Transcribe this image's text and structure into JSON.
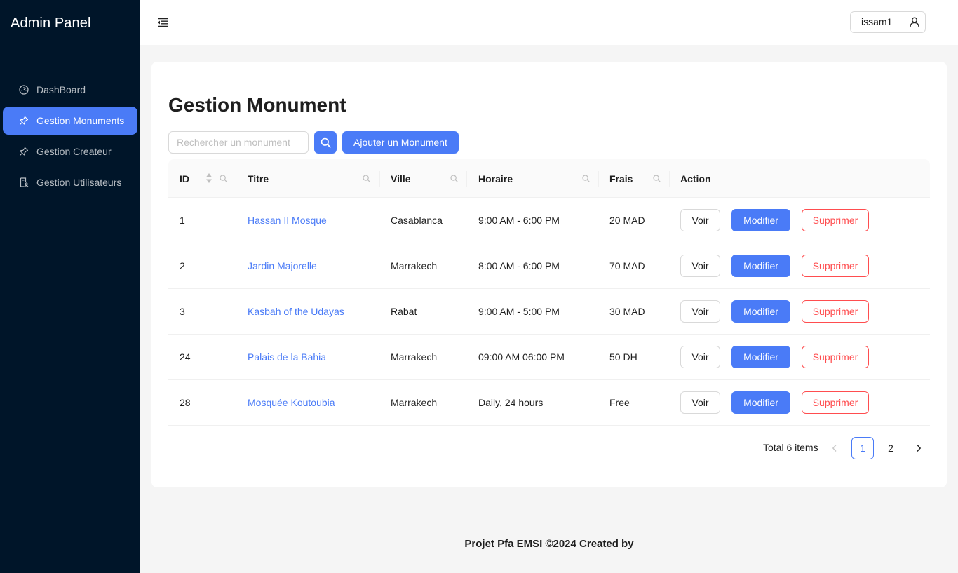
{
  "sidebar": {
    "brand": "Admin Panel",
    "items": [
      {
        "label": "DashBoard",
        "icon": "dashboard-icon",
        "active": false
      },
      {
        "label": "Gestion Monuments",
        "icon": "pushpin-icon",
        "active": true
      },
      {
        "label": "Gestion Createur",
        "icon": "pushpin-icon",
        "active": false
      },
      {
        "label": "Gestion Utilisateurs",
        "icon": "file-user-icon",
        "active": false
      }
    ]
  },
  "header": {
    "username": "issam1",
    "collapse_icon": "menu-fold-icon",
    "user_icon": "user-icon"
  },
  "main": {
    "title": "Gestion Monument",
    "search_placeholder": "Rechercher un monument",
    "search_value": "",
    "add_label": "Ajouter un Monument",
    "columns": [
      "ID",
      "Titre",
      "Ville",
      "Horaire",
      "Frais",
      "Action"
    ],
    "rows": [
      {
        "id": "1",
        "titre": "Hassan II Mosque",
        "ville": "Casablanca",
        "horaire": "9:00 AM - 6:00 PM",
        "frais": "20 MAD"
      },
      {
        "id": "2",
        "titre": "Jardin Majorelle",
        "ville": "Marrakech",
        "horaire": "8:00 AM - 6:00 PM",
        "frais": "70 MAD"
      },
      {
        "id": "3",
        "titre": "Kasbah of the Udayas",
        "ville": "Rabat",
        "horaire": "9:00 AM - 5:00 PM",
        "frais": "30 MAD"
      },
      {
        "id": "24",
        "titre": "Palais de la Bahia",
        "ville": "Marrakech",
        "horaire": "09:00 AM 06:00 PM",
        "frais": "50 DH"
      },
      {
        "id": "28",
        "titre": "Mosquée Koutoubia",
        "ville": "Marrakech",
        "horaire": "Daily, 24 hours",
        "frais": "Free"
      }
    ],
    "actions": {
      "view": "Voir",
      "edit": "Modifier",
      "delete": "Supprimer"
    },
    "pagination": {
      "total": "Total 6 items",
      "pages": [
        "1",
        "2"
      ],
      "current": "1"
    }
  },
  "footer": "Projet Pfa EMSI ©2024 Created by",
  "colors": {
    "primary": "#4a7bf7",
    "sidebar": "#001529",
    "danger": "#ff4d4f"
  }
}
